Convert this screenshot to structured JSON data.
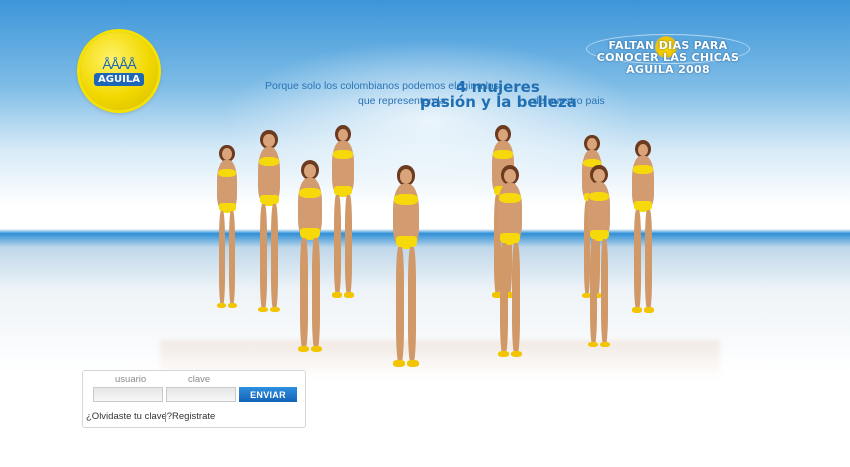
{
  "logo": {
    "figures": "ÅÅÅÅ",
    "label": "AGUILA"
  },
  "countdown": {
    "line1": "FALTAN    DIAS PARA",
    "line2": "CONOCER LAS CHICAS",
    "line3": "AGUILA 2008"
  },
  "tagline": {
    "part1": "Porque solo los colombianos podemos elegir a las",
    "part2": "que representen la",
    "part3": "de nuestro pais",
    "big1": "4 mujeres",
    "big2": "pasión y la belleza"
  },
  "login": {
    "user_label": "usuario",
    "pass_label": "clave",
    "user_value": "",
    "pass_value": "",
    "submit_label": "ENVIAR",
    "forgot_label": "¿Olvidaste tu clave?",
    "register_label": "Registrate"
  },
  "colors": {
    "sky": "#3d96d9",
    "accent_blue": "#1f6fb2",
    "bikini_yellow": "#f5d90a",
    "button_blue": "#1363b6"
  }
}
